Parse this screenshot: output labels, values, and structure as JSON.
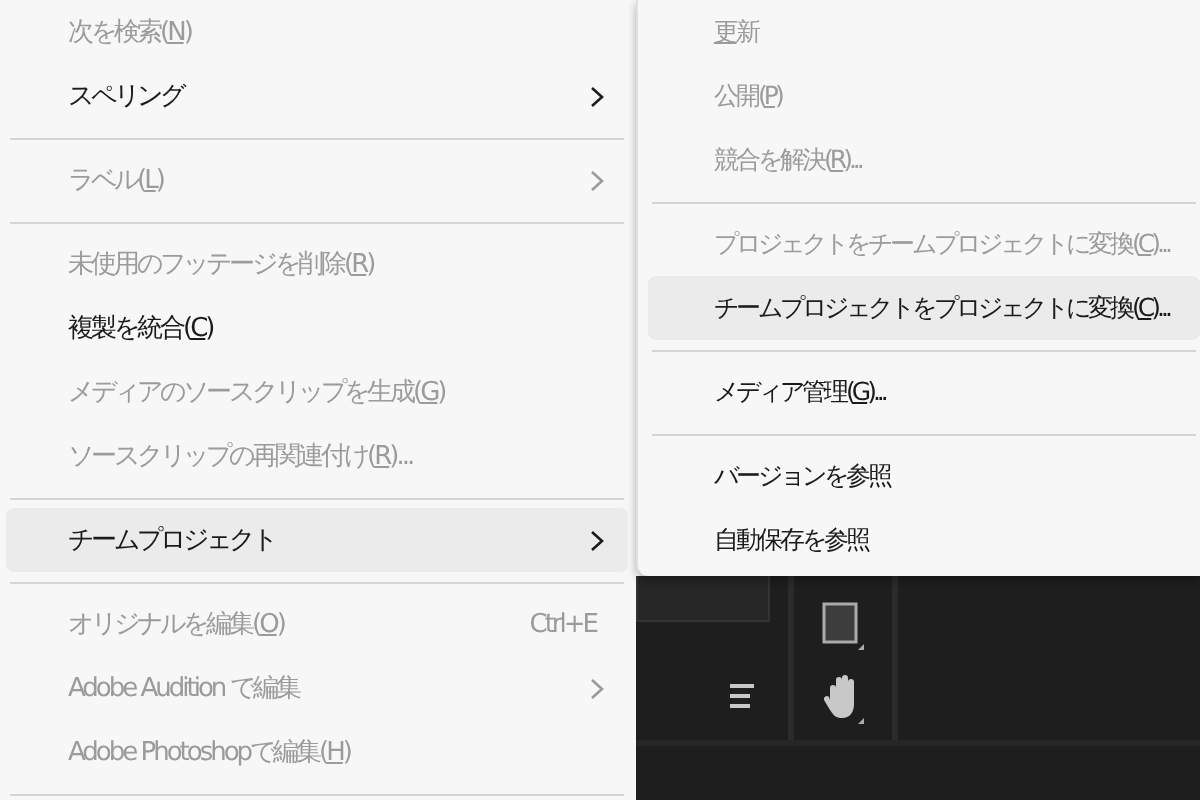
{
  "context_menu": {
    "items": [
      {
        "kind": "item",
        "before": "次を検索(",
        "mnemonic": "N",
        "after": ")",
        "disabled": true,
        "selected": false,
        "submenu": false
      },
      {
        "kind": "item",
        "before": "スペリング",
        "disabled": false,
        "selected": false,
        "submenu": true
      },
      {
        "kind": "separator"
      },
      {
        "kind": "item",
        "before": "ラベル(",
        "mnemonic": "L",
        "after": ")",
        "disabled": true,
        "selected": false,
        "submenu": true
      },
      {
        "kind": "separator"
      },
      {
        "kind": "item",
        "before": "未使用のフッテージを削除(",
        "mnemonic": "R",
        "after": ")",
        "disabled": true,
        "selected": false,
        "submenu": false
      },
      {
        "kind": "item",
        "before": "複製を統合(",
        "mnemonic": "C",
        "after": ")",
        "disabled": false,
        "selected": false,
        "submenu": false
      },
      {
        "kind": "item",
        "before": "メディアのソースクリップを生成(",
        "mnemonic": "G",
        "after": ")",
        "disabled": true,
        "selected": false,
        "submenu": false
      },
      {
        "kind": "item",
        "before": "ソースクリップの再関連付け(",
        "mnemonic": "R",
        "after": ")...",
        "disabled": true,
        "selected": false,
        "submenu": false
      },
      {
        "kind": "separator"
      },
      {
        "kind": "item",
        "before": "チームプロジェクト",
        "disabled": false,
        "selected": true,
        "submenu": true
      },
      {
        "kind": "separator"
      },
      {
        "kind": "item",
        "before": "オリジナルを編集(",
        "mnemonic": "O",
        "after": ")",
        "disabled": true,
        "selected": false,
        "submenu": false,
        "shortcut": "Ctrl+E"
      },
      {
        "kind": "item",
        "before": "Adobe Audition で編集",
        "disabled": true,
        "selected": false,
        "submenu": true
      },
      {
        "kind": "item",
        "before": "Adobe Photoshopで編集(",
        "mnemonic": "H",
        "after": ")",
        "disabled": true,
        "selected": false,
        "submenu": false
      },
      {
        "kind": "separator"
      }
    ]
  },
  "submenu": {
    "items": [
      {
        "kind": "item",
        "mnemonic": "更",
        "after": "新",
        "disabled": true,
        "selected": false
      },
      {
        "kind": "item",
        "before": "公開(",
        "mnemonic": "P",
        "after": ")",
        "disabled": true,
        "selected": false
      },
      {
        "kind": "item",
        "before": "競合を解決(",
        "mnemonic": "R",
        "after": ")...",
        "disabled": true,
        "selected": false
      },
      {
        "kind": "separator"
      },
      {
        "kind": "item",
        "before": "プロジェクトをチームプロジェクトに変換(",
        "mnemonic": "C",
        "after": ")...",
        "disabled": true,
        "selected": false
      },
      {
        "kind": "item",
        "before": "チームプロジェクトをプロジェクトに変換(",
        "mnemonic": "C",
        "after": ")...",
        "disabled": false,
        "selected": true
      },
      {
        "kind": "separator"
      },
      {
        "kind": "item",
        "before": "メディア管理(",
        "mnemonic": "G",
        "after": ")...",
        "disabled": false,
        "selected": false
      },
      {
        "kind": "separator"
      },
      {
        "kind": "item",
        "before": "バージョンを参照",
        "disabled": false,
        "selected": false
      },
      {
        "kind": "item",
        "before": "自動保存を参照",
        "disabled": false,
        "selected": false
      }
    ]
  }
}
